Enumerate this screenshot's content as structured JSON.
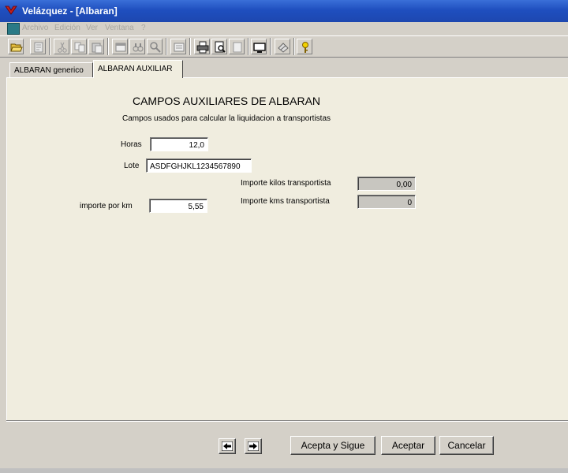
{
  "window": {
    "title": "Velázquez - [Albaran]"
  },
  "menu": [
    "Archivo",
    "Edición",
    "Ver",
    "Ventana",
    "?"
  ],
  "toolbar": {
    "icons": [
      "open-folder-icon",
      "properties-icon",
      "cut-icon",
      "copy-icon",
      "paste-icon",
      "window-icon",
      "binoculars-icon",
      "magnify-icon",
      "notes-icon",
      "print-icon",
      "print-preview-icon",
      "page-icon",
      "monitor-icon",
      "eraser-icon",
      "key-icon"
    ]
  },
  "tabs": [
    {
      "label": "ALBARAN generico",
      "active": false
    },
    {
      "label": "ALBARAN AUXILIAR",
      "active": true
    }
  ],
  "form": {
    "heading": "CAMPOS AUXILIARES DE ALBARAN",
    "subheading": "Campos usados para calcular la liquidacion a transportistas",
    "horas": {
      "label": "Horas",
      "value": "12,0"
    },
    "lote": {
      "label": "Lote",
      "value": "ASDFGHJKL1234567890"
    },
    "importe_km": {
      "label": "importe por km",
      "value": "5,55"
    },
    "importe_kilos": {
      "label": "Importe kilos transportista",
      "value": "0,00"
    },
    "importe_kms": {
      "label": "Importe kms transportista",
      "value": "0"
    }
  },
  "buttons": {
    "acepta_sigue": "Acepta y Sigue",
    "aceptar": "Aceptar",
    "cancelar": "Cancelar"
  },
  "colors": {
    "titlebar": "#1f4fbf",
    "panel": "#f0eddf",
    "chrome": "#d4d0c8"
  }
}
